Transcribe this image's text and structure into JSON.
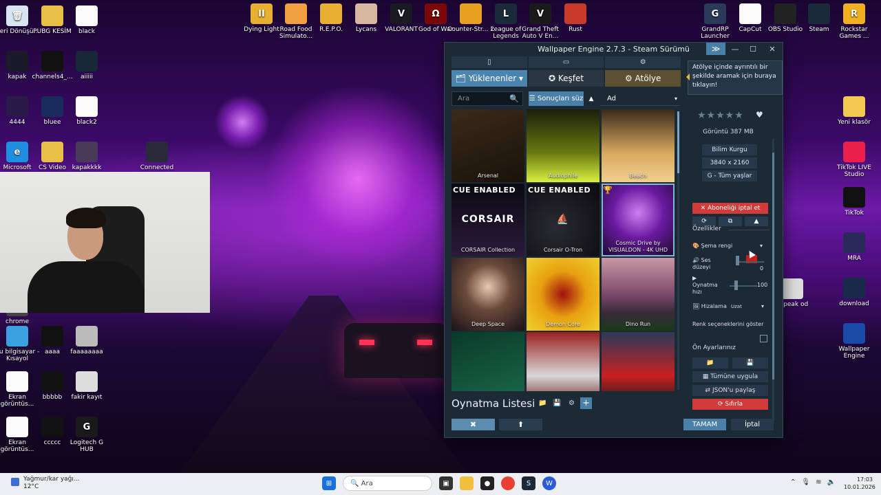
{
  "desktop_icons": [
    {
      "label": "Geri Dönüşü...",
      "color": "#d8e4ef",
      "glyph": "🗑"
    },
    {
      "label": "PUBG KESİM",
      "color": "#e8c048",
      "glyph": ""
    },
    {
      "label": "black",
      "color": "#fafafa",
      "glyph": ""
    },
    {
      "label": "kapak",
      "color": "#1a1a2a",
      "glyph": ""
    },
    {
      "label": "channels4_...",
      "color": "#111",
      "glyph": ""
    },
    {
      "label": "aiiiii",
      "color": "#182838",
      "glyph": ""
    },
    {
      "label": "4444",
      "color": "#2a1a4a",
      "glyph": ""
    },
    {
      "label": "bluee",
      "color": "#1a2a5a",
      "glyph": ""
    },
    {
      "label": "black2",
      "color": "#fafafa",
      "glyph": ""
    },
    {
      "label": "Microsoft",
      "color": "#1f8fe0",
      "glyph": "e"
    },
    {
      "label": "CS Video",
      "color": "#e8c048",
      "glyph": ""
    },
    {
      "label": "kapakkkk",
      "color": "#4a3a5a",
      "glyph": ""
    },
    {
      "label": "Connected",
      "color": "#2a2a3a",
      "glyph": ""
    },
    {
      "label": "Dying Light",
      "color": "#e6b030",
      "glyph": "II"
    },
    {
      "label": "Road Food Simulato...",
      "color": "#f0a040",
      "glyph": ""
    },
    {
      "label": "R.E.P.O.",
      "color": "#e8b030",
      "glyph": ""
    },
    {
      "label": "Lycans",
      "color": "#d8b8a0",
      "glyph": ""
    },
    {
      "label": "VALORANT",
      "color": "#1a1a22",
      "glyph": "V"
    },
    {
      "label": "God of War",
      "color": "#7a0808",
      "glyph": "Ω"
    },
    {
      "label": "Counter-Str... 2",
      "color": "#e8a020",
      "glyph": ""
    },
    {
      "label": "League of Legends",
      "color": "#1a2a3a",
      "glyph": "L"
    },
    {
      "label": "Grand Theft Auto V En...",
      "color": "#1a1a1a",
      "glyph": "V"
    },
    {
      "label": "Rust",
      "color": "#c83a2a",
      "glyph": ""
    },
    {
      "label": "GrandRP Launcher",
      "color": "#2a3a5a",
      "glyph": "G"
    },
    {
      "label": "CapCut",
      "color": "#fafafa",
      "glyph": ""
    },
    {
      "label": "OBS Studio",
      "color": "#222",
      "glyph": ""
    },
    {
      "label": "Steam",
      "color": "#1a2a3a",
      "glyph": ""
    },
    {
      "label": "Rockstar Games ...",
      "color": "#f2b020",
      "glyph": "R"
    },
    {
      "label": "Yeni klasör",
      "color": "#f2c850",
      "glyph": ""
    },
    {
      "label": "TikTok LIVE Studio",
      "color": "#e8204a",
      "glyph": ""
    },
    {
      "label": "TikTok",
      "color": "#111",
      "glyph": ""
    },
    {
      "label": "MRA",
      "color": "#2a2a5a",
      "glyph": ""
    },
    {
      "label": "download",
      "color": "#1a2a4a",
      "glyph": ""
    },
    {
      "label": "Wallpaper Engine",
      "color": "#1a4aa8",
      "glyph": ""
    },
    {
      "label": "Bu bilgisayar - Kısayol",
      "color": "#3aa0e0",
      "glyph": ""
    },
    {
      "label": "aaaa",
      "color": "#111",
      "glyph": ""
    },
    {
      "label": "faaaaaaaa",
      "color": "#bbb",
      "glyph": ""
    },
    {
      "label": "Ekran görüntüs...",
      "color": "#fafafa",
      "glyph": ""
    },
    {
      "label": "bbbbb",
      "color": "#111",
      "glyph": ""
    },
    {
      "label": "fakir kayıt",
      "color": "#ddd",
      "glyph": ""
    },
    {
      "label": "Ekran görüntüs...",
      "color": "#fafafa",
      "glyph": ""
    },
    {
      "label": "ccccc",
      "color": "#111",
      "glyph": ""
    },
    {
      "label": "Logitech G HUB",
      "color": "#1a1a1a",
      "glyph": "G"
    },
    {
      "label": "chrome",
      "color": "#444",
      "glyph": ""
    },
    {
      "label": "nspeak od",
      "color": "#ddd",
      "glyph": ""
    }
  ],
  "window": {
    "title": "Wallpaper Engine 2.7.3 - Steam Sürümü",
    "expand_glyph": "≫",
    "min_glyph": "—",
    "max_glyph": "☐",
    "close_glyph": "✕",
    "device_icons": [
      "▯",
      "▭",
      "⚙"
    ],
    "tabs": [
      {
        "label": "🗂 Yüklenenler ▾"
      },
      {
        "label": "✪ Keşfet"
      },
      {
        "label": "⚙ Atölye"
      }
    ],
    "search": {
      "placeholder": "Ara",
      "icon": "🔍"
    },
    "filter_label": "☰ Sonuçları süz",
    "sort_dir": "▲",
    "sort_value": "Ad",
    "sort_arrow": "▾",
    "tiles": [
      {
        "caption": "Arsenal",
        "bg": "linear-gradient(160deg,#3a2a1a,#1a120a)",
        "cue": "",
        "center": ""
      },
      {
        "caption": "Audiophile",
        "bg": "linear-gradient(180deg,#1a1e0a,#6a7a10 60%,#d8f040)",
        "cue": "",
        "center": ""
      },
      {
        "caption": "Beach",
        "bg": "linear-gradient(180deg,#3a2a1a,#d8a860 60%,#f0d090)",
        "cue": "",
        "center": ""
      },
      {
        "caption": "CORSAIR Collection",
        "bg": "linear-gradient(180deg,#0a0a12,#2a1a3a)",
        "cue": "CUE ENABLED",
        "center": "CORSAIR"
      },
      {
        "caption": "Corsair O-Tron",
        "bg": "radial-gradient(circle at 40% 60%,#2a2a32,#0a0a0e)",
        "cue": "CUE ENABLED",
        "center": "⛵"
      },
      {
        "caption": "Cosmic Drive by VISUALDON - 4K UHD",
        "bg": "radial-gradient(circle at 50% 40%,#d080f0,#6a1aa0 45%,#1a0a2a)",
        "cue": "🏆",
        "center": ""
      },
      {
        "caption": "Deep Space",
        "bg": "radial-gradient(circle at 50% 40%,#e8c8b0,#6a4a3a 40%,#1a1218)",
        "cue": "",
        "center": ""
      },
      {
        "caption": "Demon Core",
        "bg": "radial-gradient(circle at 50% 50%,#a01010,#e8a010 45%,#f0d030)",
        "cue": "",
        "center": ""
      },
      {
        "caption": "Dino Run",
        "bg": "linear-gradient(180deg,#c898a8,#7a4a6a 50%,#3a2a3a 75%,#1a3a1a)",
        "cue": "",
        "center": ""
      },
      {
        "caption": "",
        "bg": "linear-gradient(160deg,#0a3a2a,#1a6a4a)",
        "cue": "",
        "center": ""
      },
      {
        "caption": "",
        "bg": "linear-gradient(180deg,#9a2020,#d8d8d8 60%,#702020)",
        "cue": "",
        "center": ""
      },
      {
        "caption": "",
        "bg": "linear-gradient(180deg,#2a3a5a,#c82020 60%,#1a1a1a)",
        "cue": "",
        "center": ""
      }
    ],
    "playlist": {
      "title": "Oynatma Listesi",
      "buttons": [
        "📁",
        "💾",
        "⚙",
        "+"
      ]
    },
    "bottom_left_buttons": [
      "✖",
      "⬆"
    ],
    "ok_label": "TAMAM",
    "cancel_label": "İptal"
  },
  "tooltip": "Atölye içinde ayrıntılı bir şekilde aramak için buraya tıklayın!",
  "details": {
    "stars": "★★★★★",
    "heart": "♥",
    "size": "Görüntü 387 MB",
    "genre": "Bilim Kurgu",
    "resolution": "3840 x 2160",
    "rating": "G - Tüm yaşlar",
    "unsubscribe": "✕ Aboneliği iptal et",
    "small_buttons": [
      "⟳",
      "⧉",
      "▲"
    ],
    "properties_header": "Özellikler",
    "scheme_color_label": "Şema rengi",
    "scheme_color_value": "#c81e1e",
    "volume_label": "Ses düzeyi",
    "volume_value": "0",
    "rate_label": "Oynatma hızı",
    "rate_value": "100",
    "align_label": "Hizalama",
    "align_value": "Uzat",
    "color_opts_label": "Renk seçeneklerini göster",
    "presets_header": "Ön Ayarlarınız",
    "preset_buttons": [
      "📁",
      "💾"
    ],
    "apply_all": "Tümüne uygula",
    "share_json": "JSON'u paylaş",
    "reset": "Sıfırla"
  },
  "taskbar": {
    "weather_line1": "Yağmur/kar yağı...",
    "weather_line2": "12°C",
    "search_placeholder": "Ara",
    "time": "17:03",
    "date": "10.01.2026"
  }
}
